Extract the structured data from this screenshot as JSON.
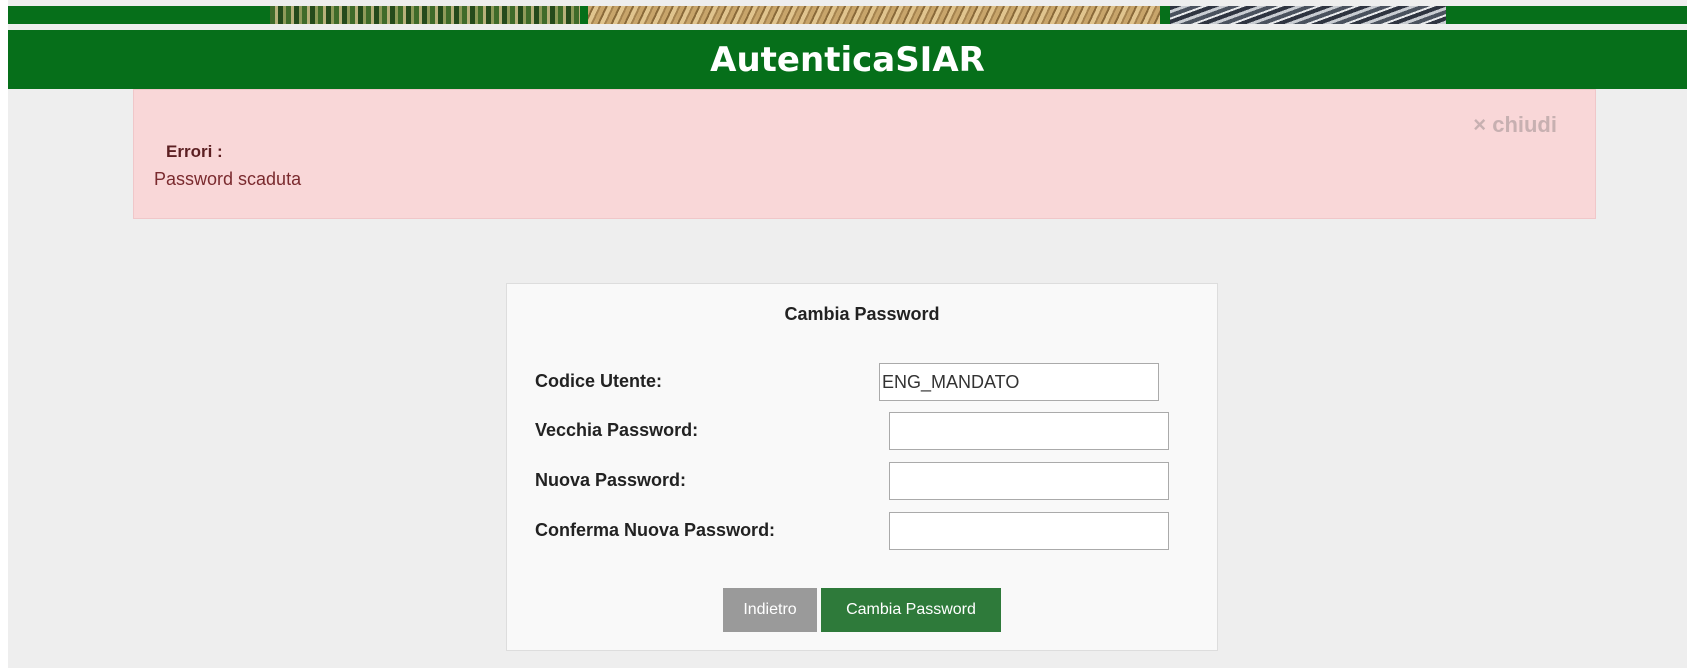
{
  "header": {
    "title": "AutenticaSIAR"
  },
  "alert": {
    "close_label": "× chiudi",
    "title": "Errori :",
    "message": "Password scaduta"
  },
  "form": {
    "title": "Cambia Password",
    "fields": [
      {
        "label": "Codice Utente:",
        "value": "ENG_MANDATO"
      },
      {
        "label": "Vecchia Password:",
        "value": ""
      },
      {
        "label": "Nuova Password:",
        "value": ""
      },
      {
        "label": "Conferma Nuova Password:",
        "value": ""
      }
    ],
    "back_label": "Indietro",
    "submit_label": "Cambia Password"
  },
  "colors": {
    "brand_green": "#066f1a",
    "alert_bg": "#f9d7d8",
    "submit_bg": "#2e7a3a",
    "back_bg": "#9a9a9a"
  }
}
